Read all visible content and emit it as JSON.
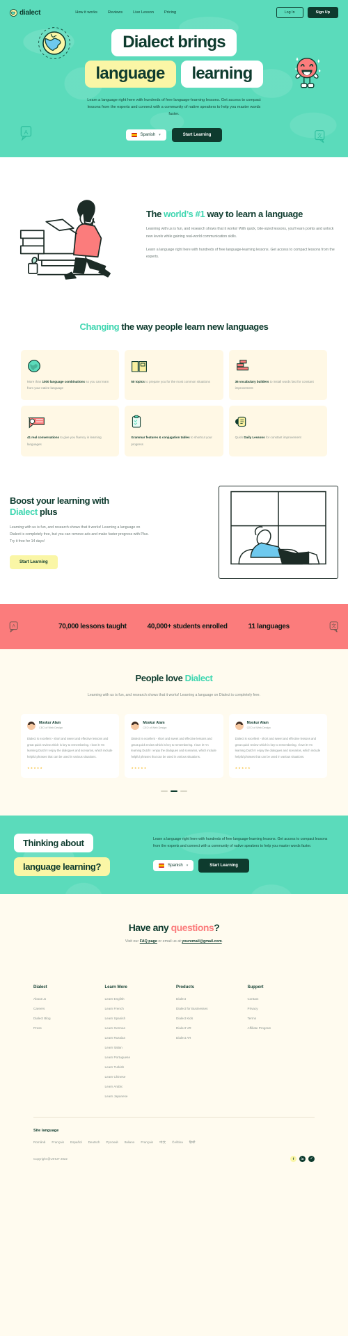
{
  "brand": {
    "name": "dialect",
    "logo_icon": "globe-logo-icon"
  },
  "nav": {
    "links": [
      "How it works",
      "Reviews",
      "Live Lesson",
      "Pricing"
    ],
    "login_label": "Log In",
    "signup_label": "Sign Up"
  },
  "hero": {
    "line1": "Dialect brings",
    "line2a": "language",
    "line2b": "learning",
    "subtitle": "Learn a language right here with hundreds of free language-learning lessons. Get access to compact lessons from the experts and connect with a community of native speakers to help you master words faster.",
    "language_value": "Spanish",
    "cta_label": "Start Learning"
  },
  "world": {
    "title_pre": "The ",
    "title_accent": "world’s #1",
    "title_post": " way to learn a language",
    "p1": "Learning with us is fun, and research shows that it works! With quick, bite-sized lessons, you’ll earn points and unlock new levels while gaining real-world communication skills.",
    "p2": "Learn a language right here with hundreds of free language-learning lessons. Get access to compact lessons from the experts."
  },
  "changing": {
    "title_accent": "Changing",
    "title_rest": " the way people learn new languages",
    "cards": [
      {
        "icon": "globe-icon",
        "bold": "1000 language combinations",
        "pre": "More than ",
        "post": " so you can learn from your native language"
      },
      {
        "icon": "open-book-icon",
        "bold": "50 topics",
        "pre": "",
        "post": " to prepare you for the most common situations"
      },
      {
        "icon": "brick-wall-icon",
        "bold": "36 vocabulary builders",
        "pre": "",
        "post": " to install words fast for constant improvement"
      },
      {
        "icon": "speech-bubble-icon",
        "bold": "41 real conversations",
        "pre": "",
        "post": " to give you fluency in learning languages"
      },
      {
        "icon": "clipboard-icon",
        "bold": "Grammar features & conjugation tables",
        "pre": "",
        "post": " to shortcut your progress"
      },
      {
        "icon": "smartwatch-icon",
        "bold": "Daily Lessons",
        "pre": "Quick ",
        "post": " for constant improvement"
      }
    ]
  },
  "boost": {
    "title_l1": "Boost your learning with",
    "title_accent": "Dialect",
    "title_rest": " plus",
    "paragraph": "Learning with us is fun, and research shows that it works! Learning a language on Dialect is completely free, but you can remove ads and make faster progress with Plus. Try it free for 14 days!",
    "cta_label": "Start Learning"
  },
  "stats": {
    "items": [
      "70,000 lessons taught",
      "40,000+ students enrolled",
      "11 languages"
    ],
    "left_icon": "translate-badge-icon",
    "right_icon": "translate-badge-icon"
  },
  "testimonials": {
    "title_pre": "People love ",
    "title_accent": "Dialect",
    "subtitle": "Learning with us is fun, and research shows that it works! Learning a language on Dialect is completely free.",
    "cards": [
      {
        "name": "Moskur Alam",
        "role": "CEO of Web Design",
        "text": "Dialect is excellent - short and sweet and effective lessons and great quick review which is key to remembering. I love it! I'm learning Dutch! I enjoy the dialogues and scenarios, which include helpful phrases that can be used in various situations.",
        "rating": 5
      },
      {
        "name": "Moskur Alam",
        "role": "CEO of Web Design",
        "text": "Dialect is excellent - short and sweet and effective lessons and great quick review which is key to remembering. I love it! I'm learning Dutch! I enjoy the dialogues and scenarios, which include helpful phrases that can be used in various situations.",
        "rating": 5
      },
      {
        "name": "Moskur Alam",
        "role": "CEO of Web Design",
        "text": "Dialect is excellent - short and sweet and effective lessons and great quick review which is key to remembering. I love it! I'm learning Dutch! I enjoy the dialogues and scenarios, which include helpful phrases that can be used in various situations.",
        "rating": 5
      }
    ],
    "carousel": {
      "active_index": 1,
      "count": 3
    }
  },
  "cta_band": {
    "pill1": "Thinking about",
    "pill2": "language learning?",
    "paragraph": "Learn a language right here with hundreds of free language-learning lessons. Get access to compact lessons from the experts and connect with a community of native speakers to help you master words faster.",
    "language_value": "Spanish",
    "cta_label": "Start Learning"
  },
  "questions": {
    "title_pre": "Have any ",
    "title_accent": "questions",
    "title_post": "?",
    "sub_pre": "Visit our ",
    "link1": "FAQ page",
    "sub_mid": " or email us at ",
    "link2": "youremail@gmail.com",
    "sub_post": "."
  },
  "footer": {
    "columns": [
      {
        "heading": "Dialect",
        "items": [
          "About us",
          "Careers",
          "Dialect Blog",
          "Press"
        ]
      },
      {
        "heading": "Learn More",
        "items": [
          "Learn English",
          "Learn French",
          "Learn Spanish",
          "Learn German",
          "Learn Russian",
          "Learn Italian",
          "Learn Portuguese",
          "Learn Turkish",
          "Learn Chinese",
          "Learn Arabic",
          "Learn Japanese"
        ]
      },
      {
        "heading": "Products",
        "items": [
          "Dialect",
          "Dialect for Businesses",
          "Dialect Kids",
          "Dialect VR",
          "Dialect AR"
        ]
      },
      {
        "heading": "Support",
        "items": [
          "Contact",
          "Privacy",
          "Terms",
          "Affiliate Program"
        ]
      }
    ],
    "site_language_heading": "Site language",
    "site_languages": [
      "Română",
      "Français",
      "Español",
      "Deutsch",
      "Русский",
      "Italiano",
      "Français",
      "中文",
      "Čeština",
      "हिन्दी"
    ],
    "copyright": "Copyright @UIHUT 2022",
    "socials": [
      {
        "name": "facebook-icon",
        "glyph": "f"
      },
      {
        "name": "linkedin-icon",
        "glyph": "in"
      },
      {
        "name": "twitter-icon",
        "glyph": "✓"
      }
    ]
  },
  "colors": {
    "mint": "#5BDBBB",
    "dark_green": "#0E3B2E",
    "yellow": "#FAF6A6",
    "coral": "#FB7C7C",
    "cream": "#FFFBEF",
    "accent_teal": "#3ED6B0"
  }
}
